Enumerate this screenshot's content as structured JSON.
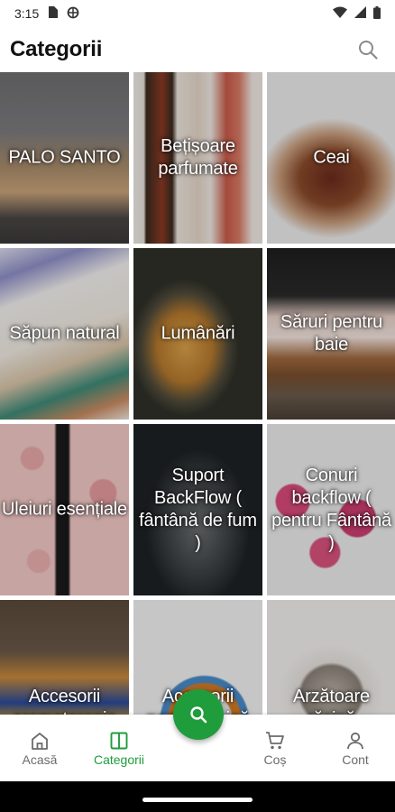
{
  "status_bar": {
    "time": "3:15"
  },
  "header": {
    "title": "Categorii"
  },
  "categories": [
    {
      "label": "PALO SANTO"
    },
    {
      "label": "Bețișoare parfumate"
    },
    {
      "label": "Ceai"
    },
    {
      "label": "Săpun natural"
    },
    {
      "label": "Lumânări"
    },
    {
      "label": "Săruri pentru baie"
    },
    {
      "label": "Uleiuri esențiale"
    },
    {
      "label": "Suport BackFlow ( fântână de fum )"
    },
    {
      "label": "Conuri backflow ( pentru Fântână )"
    },
    {
      "label": "Accesorii aromaterapie"
    },
    {
      "label": "Accesorii pentru rășină"
    },
    {
      "label": "Arzătoare rășină"
    }
  ],
  "bottom_nav": {
    "items": [
      {
        "label": "Acasă",
        "icon": "home-icon"
      },
      {
        "label": "Categorii",
        "icon": "categories-icon",
        "active": true
      },
      {
        "label": "Coș",
        "icon": "cart-icon"
      },
      {
        "label": "Cont",
        "icon": "account-icon"
      }
    ],
    "fab_icon": "search-icon"
  },
  "colors": {
    "accent": "#1f9d3c",
    "text": "#111111",
    "inactive": "#6b6b6b"
  }
}
